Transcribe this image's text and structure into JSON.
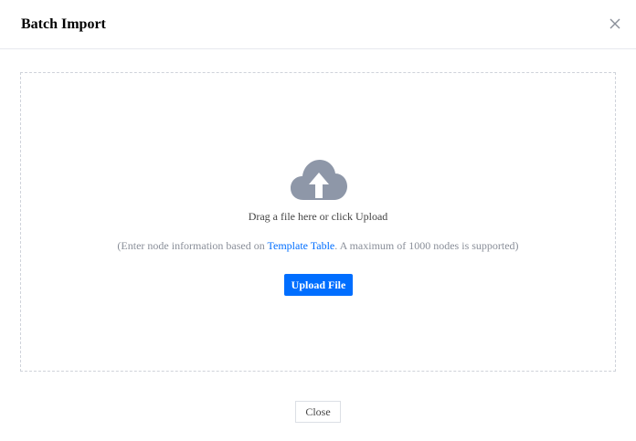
{
  "dialog": {
    "title": "Batch Import",
    "close_icon": "close-icon"
  },
  "dropzone": {
    "icon": "cloud-upload-icon",
    "icon_color": "#8e97a8",
    "drag_text": "Drag a file here or click Upload",
    "hint_prefix": "(Enter node information based on ",
    "hint_link": "Template Table",
    "hint_suffix": ". A maximum of 1000 nodes is supported)",
    "upload_label": "Upload File"
  },
  "footer": {
    "close_label": "Close"
  },
  "colors": {
    "accent": "#006eff",
    "muted_text": "#8a8f99",
    "border_dashed": "#cfd3da"
  }
}
